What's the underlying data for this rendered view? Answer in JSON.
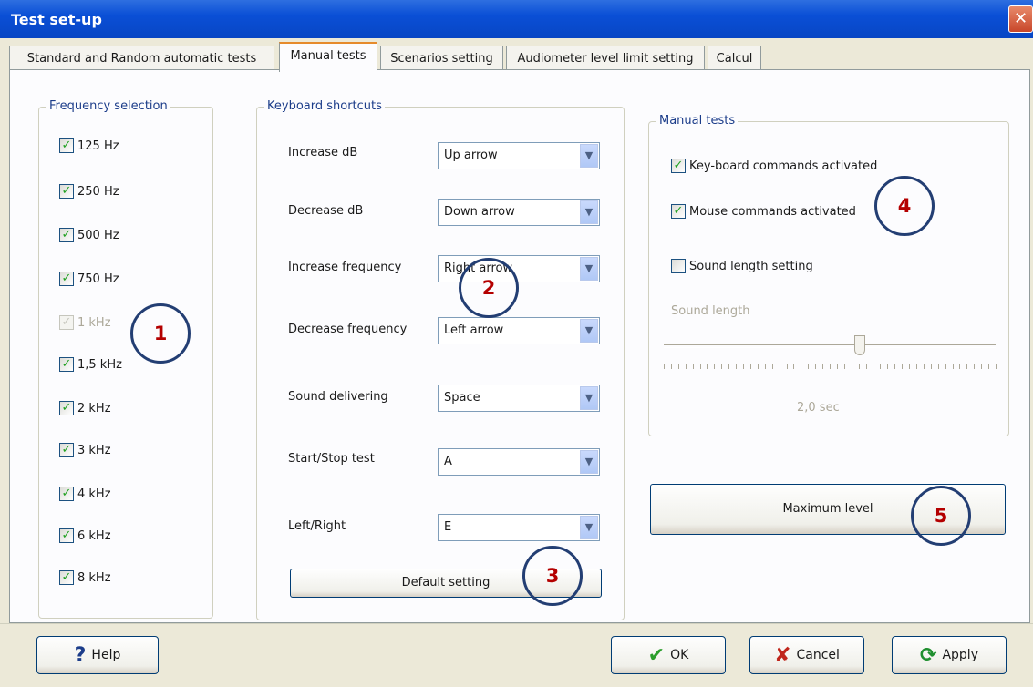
{
  "window": {
    "title": "Test set-up",
    "close_glyph": "✕"
  },
  "tabs": [
    {
      "label": "Standard and Random automatic tests"
    },
    {
      "label": "Manual tests"
    },
    {
      "label": "Scenarios setting"
    },
    {
      "label": "Audiometer level limit setting"
    },
    {
      "label": "Calcul"
    }
  ],
  "frequency_selection": {
    "title": "Frequency selection",
    "items": [
      {
        "label": "125 Hz",
        "checked": true,
        "disabled": false
      },
      {
        "label": "250 Hz",
        "checked": true,
        "disabled": false
      },
      {
        "label": "500 Hz",
        "checked": true,
        "disabled": false
      },
      {
        "label": "750 Hz",
        "checked": true,
        "disabled": false
      },
      {
        "label": "1 kHz",
        "checked": true,
        "disabled": true
      },
      {
        "label": "1,5 kHz",
        "checked": true,
        "disabled": false
      },
      {
        "label": "2 kHz",
        "checked": true,
        "disabled": false
      },
      {
        "label": "3 kHz",
        "checked": true,
        "disabled": false
      },
      {
        "label": "4 kHz",
        "checked": true,
        "disabled": false
      },
      {
        "label": "6 kHz",
        "checked": true,
        "disabled": false
      },
      {
        "label": "8 kHz",
        "checked": true,
        "disabled": false
      }
    ]
  },
  "keyboard_shortcuts": {
    "title": "Keyboard shortcuts",
    "rows": [
      {
        "label": "Increase dB",
        "value": "Up arrow"
      },
      {
        "label": "Decrease dB",
        "value": "Down arrow"
      },
      {
        "label": "Increase frequency",
        "value": "Right arrow"
      },
      {
        "label": "Decrease frequency",
        "value": "Left arrow"
      },
      {
        "label": "Sound delivering",
        "value": "Space"
      },
      {
        "label": "Start/Stop test",
        "value": "A"
      },
      {
        "label": "Left/Right",
        "value": "E"
      }
    ],
    "default_button": "Default setting"
  },
  "manual_tests": {
    "title": "Manual tests",
    "keyboard_commands": {
      "label": "Key-board commands activated",
      "checked": true
    },
    "mouse_commands": {
      "label": "Mouse commands activated",
      "checked": true
    },
    "sound_length_setting": {
      "label": "Sound length setting",
      "checked": false
    },
    "sound_length_label": "Sound length",
    "sound_length_value": "2,0 sec",
    "slider_fraction": 0.59
  },
  "maximum_level_button": "Maximum level",
  "annotations": [
    "1",
    "2",
    "3",
    "4",
    "5"
  ],
  "footer": {
    "help": "Help",
    "ok": "OK",
    "cancel": "Cancel",
    "apply": "Apply"
  },
  "icons": {
    "help": "help-question-icon",
    "ok": "check-icon",
    "cancel": "cross-icon",
    "apply": "refresh-icon",
    "close": "close-icon"
  },
  "colors": {
    "titlebar": "#0a4fd6",
    "active_tab_accent": "#e68b2c",
    "checkmark": "#21a121",
    "annotation_circle": "#233e73",
    "annotation_number": "#b40000"
  }
}
